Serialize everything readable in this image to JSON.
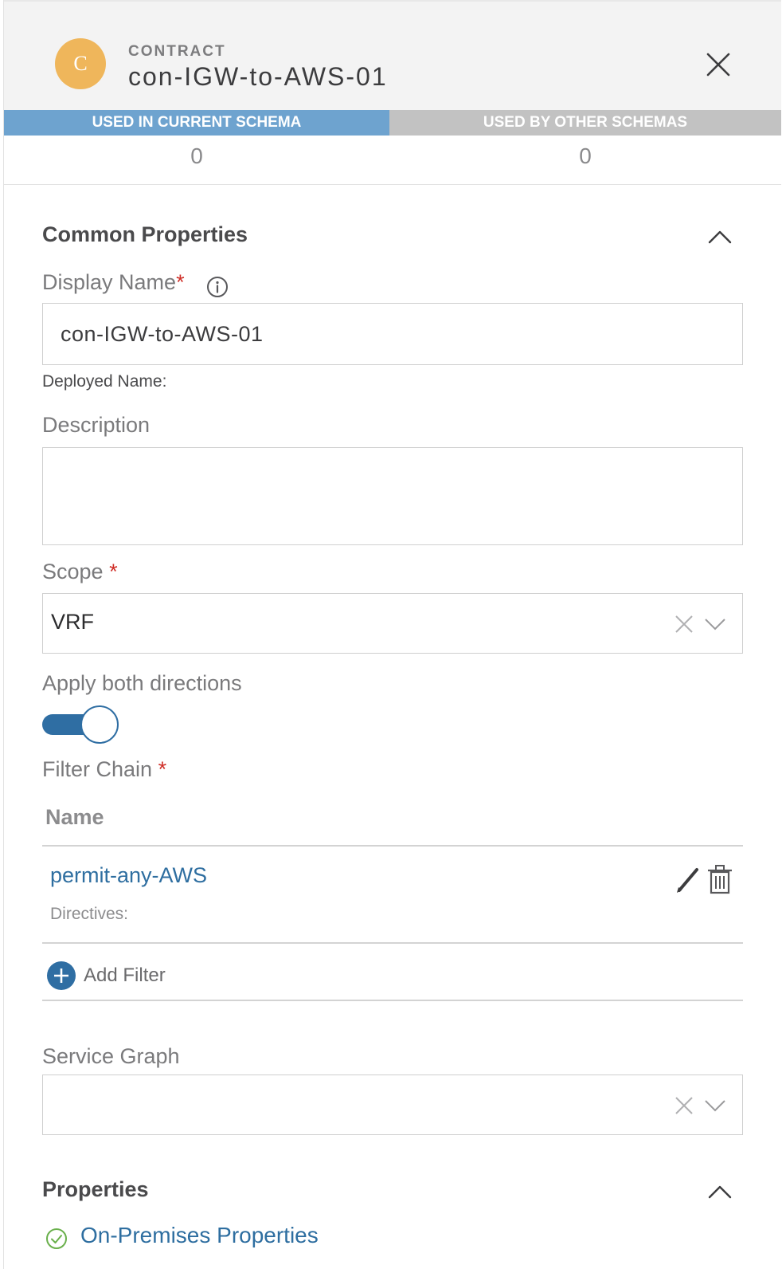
{
  "header": {
    "avatar_letter": "C",
    "object_type": "CONTRACT",
    "object_name": "con-IGW-to-AWS-01"
  },
  "usage": {
    "current_label": "USED IN CURRENT SCHEMA",
    "current_count": "0",
    "other_label": "USED BY OTHER SCHEMAS",
    "other_count": "0"
  },
  "common": {
    "section_title": "Common Properties",
    "display_name_label": "Display Name",
    "display_name_value": "con-IGW-to-AWS-01",
    "deployed_name_label": "Deployed Name:",
    "description_label": "Description",
    "description_value": "",
    "scope_label": "Scope",
    "scope_value": "VRF",
    "apply_both_label": "Apply both directions",
    "apply_both_on": true,
    "filter_chain_label": "Filter Chain",
    "required_mark": "*",
    "filter_table": {
      "column_name": "Name",
      "rows": [
        {
          "name": "permit-any-AWS",
          "directives_label": "Directives:"
        }
      ]
    },
    "add_filter_label": "Add Filter",
    "service_graph_label": "Service Graph",
    "service_graph_value": ""
  },
  "properties": {
    "section_title": "Properties",
    "on_premises_label": "On-Premises Properties"
  },
  "colors": {
    "accent": "#2f6ea3",
    "avatar": "#efb65b",
    "usage_current": "#6ea3cf",
    "usage_other": "#c2c2c2",
    "required": "#cf2e27",
    "success": "#6ab04c"
  },
  "icons": [
    "close-icon",
    "chevron-up-icon",
    "info-icon",
    "clear-icon",
    "chevron-down-icon",
    "pencil-icon",
    "trash-icon",
    "plus-circle-icon",
    "check-circle-icon"
  ]
}
